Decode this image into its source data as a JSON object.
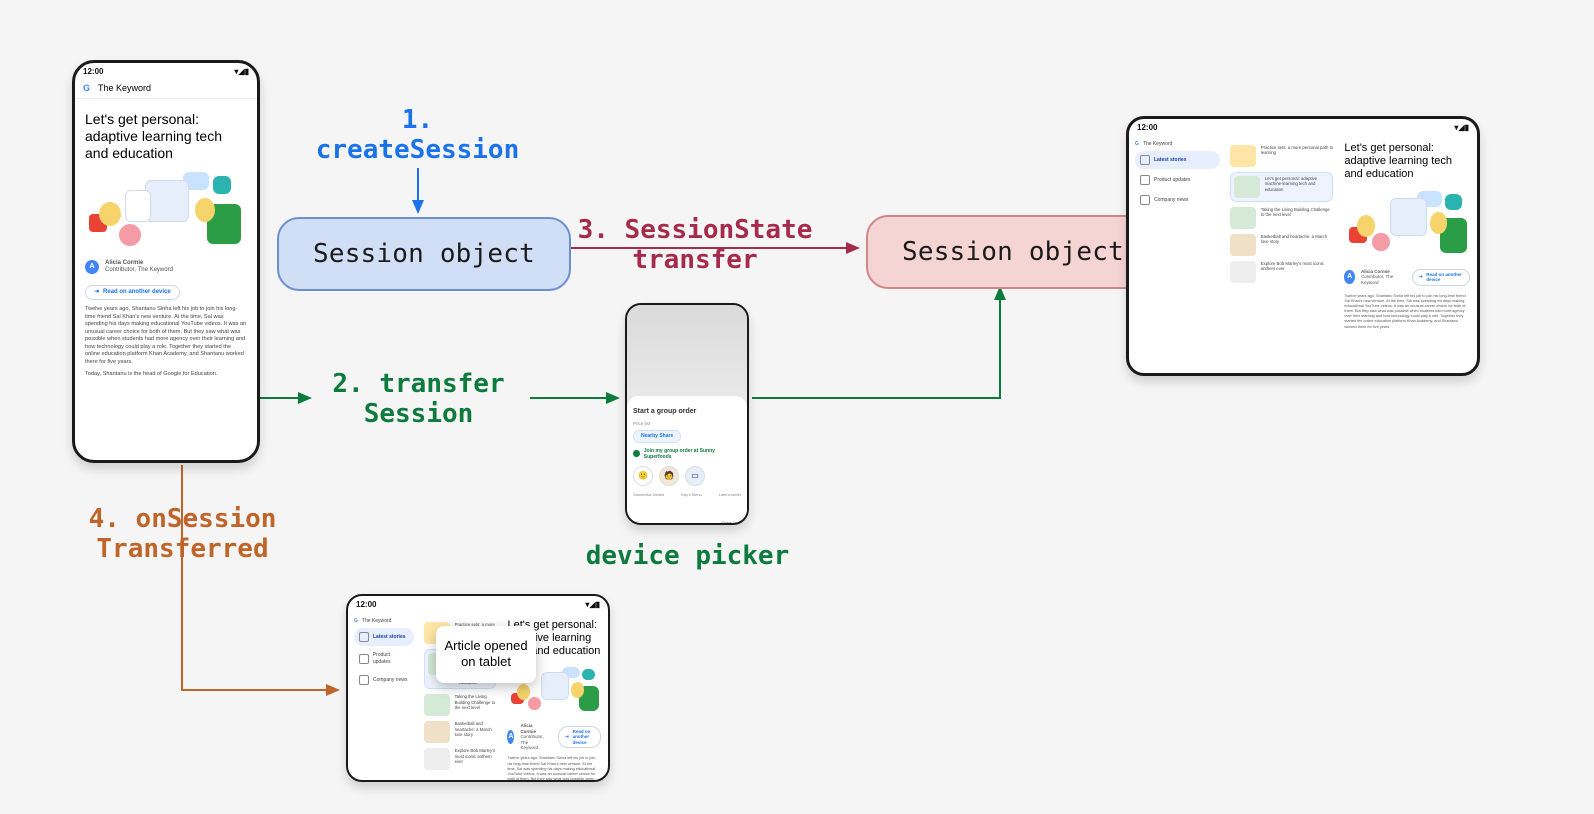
{
  "phone": {
    "time": "12:00",
    "status_icons": "▾◢▮",
    "app_title": "The Keyword",
    "headline": "Let's get personal: adaptive learning tech and education",
    "author_initial": "A",
    "author_name": "Alicia Cormie",
    "author_role": "Contributor, The Keyword",
    "read_btn": "Read on another device",
    "body": "Twelve years ago, Shantanu Sinha left his job to join his long-time friend Sal Khan's new venture. At the time, Sal was spending his days making educational YouTube videos. It was an unusual career choice for both of them. But they saw what was possible when students had more agency over their learning and how technology could play a role. Together they started the online education platform Khan Academy, and Shantanu worked there for five years.",
    "body_more": "Today, Shantanu is the head of Google for Education."
  },
  "labels": {
    "l1": "1. createSession",
    "l2": "2. transfer Session",
    "l3": "3. SessionState transfer",
    "l4": "4. onSession Transferred",
    "device_picker": "device picker"
  },
  "cards": {
    "left": "Session object",
    "right": "Session object"
  },
  "picker": {
    "sheet_title": "Start a group order",
    "subhead": "Price list",
    "pill": "Nearby Share",
    "row": "Join my group order at Sunny Superfoods",
    "captions": [
      "Samantha James",
      "Kay's Menu",
      "Liam's tablet"
    ],
    "footer_left": "◯",
    "footer_right": "Share link"
  },
  "tablet": {
    "time": "12:00",
    "status_icons": "▾◢▮",
    "app_title": "The Keyword",
    "sidebar": [
      {
        "icon": "",
        "label": "Latest stories",
        "active": true
      },
      {
        "icon": "",
        "label": "Product updates",
        "active": false
      },
      {
        "icon": "",
        "label": "Company news",
        "active": false
      }
    ],
    "stories": [
      {
        "title": "Practice sets: a more personal path to learning",
        "hl": false,
        "cls": "t-a"
      },
      {
        "title": "Let's get personal: adaptive machine-learning tech and education",
        "hl": true,
        "cls": "t-b"
      },
      {
        "title": "Taking the Living Building Challenge to the next level",
        "hl": false,
        "cls": "t-b"
      },
      {
        "title": "Basketball and heartache: a March love story",
        "hl": false,
        "cls": "t-c"
      },
      {
        "title": "Explore Bob Marley's most iconic anthem ever",
        "hl": false,
        "cls": "t-d"
      }
    ],
    "headline": "Let's get personal: adaptive learning tech and education",
    "body": "Twelve years ago, Shantanu Sinha left his job to join his long-time friend Sal Khan's new venture. At the time, Sal was spending his days making educational YouTube videos. It was an unusual career choice for both of them. But they saw what was possible when students had more agency over their learning and how technology could play a role. Together they started the online education platform Khan Academy, and Shantanu worked there for five years.",
    "author_initial": "A",
    "author_name": "Alicia Cormie",
    "author_role": "Contributor, The Keyword",
    "read_btn": "Read on another device"
  },
  "toast": "Article opened on tablet"
}
